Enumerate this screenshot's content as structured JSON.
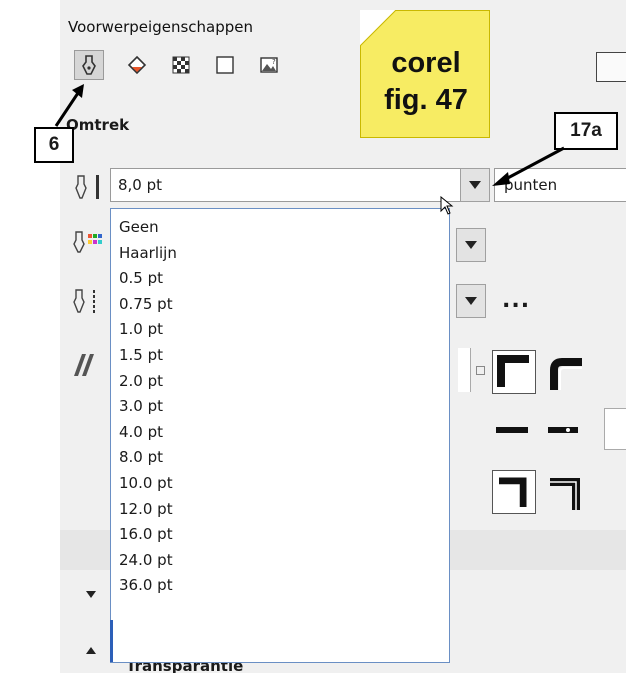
{
  "panel": {
    "title": "Voorwerpeigenschappen"
  },
  "tabs": [
    {
      "icon": "pen-outline-icon"
    },
    {
      "icon": "fill-bucket-icon"
    },
    {
      "icon": "pattern-grid-icon"
    },
    {
      "icon": "transparency-square-icon"
    },
    {
      "icon": "bitmap-image-icon"
    }
  ],
  "section": {
    "title": "Omtrek"
  },
  "outline_width": {
    "value": "8,0 pt",
    "unit": "punten",
    "options": [
      "Geen",
      "Haarlijn",
      "0.5 pt",
      "0.75 pt",
      "1.0 pt",
      "1.5 pt",
      "2.0 pt",
      "3.0 pt",
      "4.0 pt",
      "8.0 pt",
      "10.0 pt",
      "12.0 pt",
      "16.0 pt",
      "24.0 pt",
      "36.0 pt"
    ]
  },
  "more_button": {
    "label": "..."
  },
  "lower_section": {
    "label": "Transparantie"
  },
  "annotations": {
    "note": {
      "line1": "corel",
      "line2": "fig. 47"
    },
    "callout_6": "6",
    "callout_17a": "17a"
  },
  "colors": {
    "note_fill": "#f7ec63",
    "dropdown_border": "#6a8fc4",
    "panel_bg": "#f0f0f0"
  }
}
